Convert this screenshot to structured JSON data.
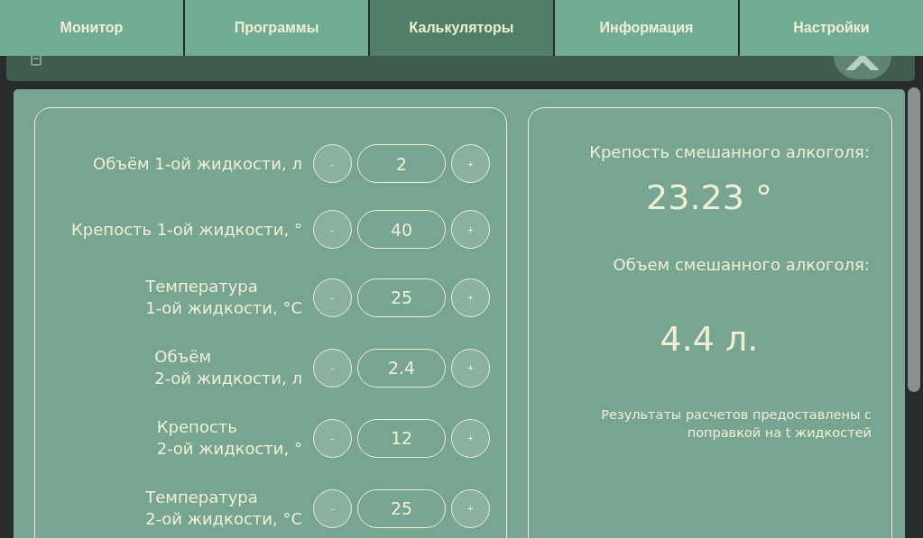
{
  "tabs": [
    {
      "label": "Монитор",
      "selected": false
    },
    {
      "label": "Программы",
      "selected": false
    },
    {
      "label": "Калькуляторы",
      "selected": true
    },
    {
      "label": "Информация",
      "selected": false
    },
    {
      "label": "Настройки",
      "selected": false
    }
  ],
  "inputs": [
    {
      "label": "Объём 1-ой жидкости, л",
      "minus": "-",
      "value": "2",
      "plus": "+"
    },
    {
      "label": "Крепость 1-ой жидкости, °",
      "minus": "-",
      "value": "40",
      "plus": "+"
    },
    {
      "label": "Температура\n1-ой жидкости, °C",
      "minus": "-",
      "value": "25",
      "plus": "+"
    },
    {
      "label": "Объём\n2-ой жидкости, л",
      "minus": "-",
      "value": "2.4",
      "plus": "+"
    },
    {
      "label": "Крепость\n2-ой жидкости, °",
      "minus": "-",
      "value": "12",
      "plus": "+"
    },
    {
      "label": "Температура\n2-ой жидкости, °C",
      "minus": "-",
      "value": "25",
      "plus": "+"
    }
  ],
  "results": [
    {
      "label": "Крепость смешанного алкоголя:",
      "value": "23.23 °"
    },
    {
      "label": "Объем смешанного алкоголя:",
      "value": "4.4 л."
    }
  ],
  "note": "Результаты расчетов предоставлены с\nпоправкой на t жидкостей"
}
